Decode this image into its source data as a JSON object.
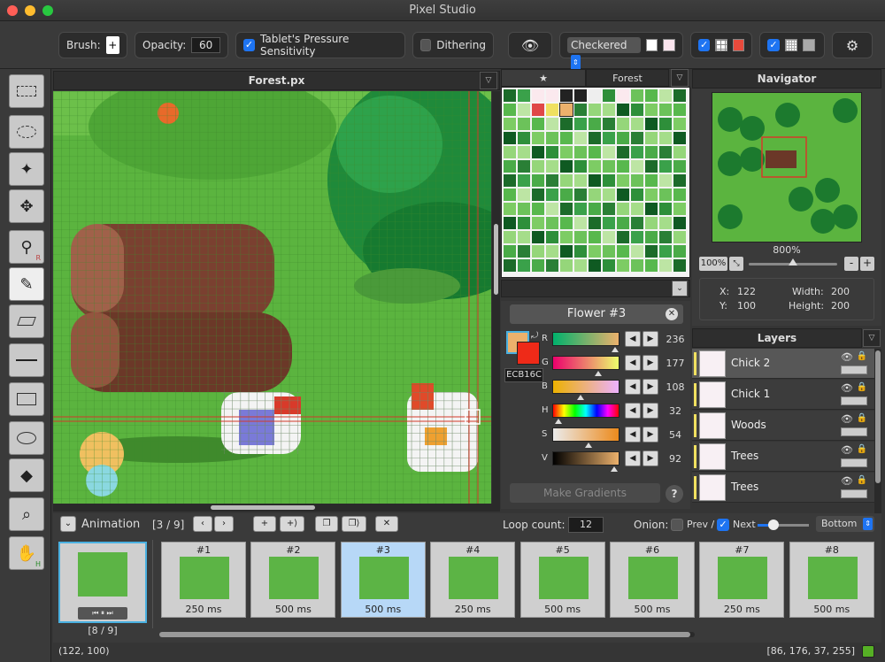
{
  "app": {
    "title": "Pixel Studio"
  },
  "toolbar": {
    "brush_label": "Brush:",
    "brush_value": "+",
    "opacity_label": "Opacity:",
    "opacity_value": "60",
    "pressure_label": "Tablet's Pressure Sensitivity",
    "pressure_checked": true,
    "dithering_label": "Dithering",
    "dithering_checked": false,
    "background_mode": "Checkered",
    "background_options": [
      "Checkered"
    ]
  },
  "tools": [
    "active-color-swatch",
    "rect-select-icon",
    "lasso-icon",
    "magic-wand-icon",
    "move-icon",
    "eyedropper-icon",
    "pencil-icon",
    "eraser-icon",
    "line-icon",
    "rectangle-icon",
    "ellipse-icon",
    "fill-bucket-icon",
    "zoom-icon",
    "hand-icon"
  ],
  "canvas": {
    "title": "Forest.px"
  },
  "palette": {
    "tab_favorites": "★",
    "tab_name": "Forest"
  },
  "color": {
    "name": "Flower #3",
    "hex": "ECB16C",
    "primary": "#ecb16c",
    "secondary": "#ee2a18",
    "sliders": [
      {
        "label": "R",
        "value": "236",
        "pos": 0.93
      },
      {
        "label": "G",
        "value": "177",
        "pos": 0.69
      },
      {
        "label": "B",
        "value": "108",
        "pos": 0.42
      },
      {
        "label": "H",
        "value": "32",
        "pos": 0.09
      },
      {
        "label": "S",
        "value": "54",
        "pos": 0.54
      },
      {
        "label": "V",
        "value": "92",
        "pos": 0.92
      }
    ],
    "make_gradients_label": "Make Gradients",
    "help_label": "?"
  },
  "navigator": {
    "title": "Navigator",
    "zoom_percent": "800%",
    "zoom_button": "100%",
    "zoom_level": 0.5,
    "x_label": "X:",
    "x_value": "122",
    "y_label": "Y:",
    "y_value": "100",
    "width_label": "Width:",
    "width_value": "200",
    "height_label": "Height:",
    "height_value": "200"
  },
  "layers": {
    "title": "Layers",
    "items": [
      {
        "name": "Chick 2",
        "locked": false
      },
      {
        "name": "Chick 1",
        "locked": false
      },
      {
        "name": "Woods",
        "locked": true
      },
      {
        "name": "Trees",
        "locked": false
      },
      {
        "name": "Trees",
        "locked": false
      }
    ]
  },
  "animation": {
    "label": "Animation",
    "counter": "[3 / 9]",
    "loop_label": "Loop count:",
    "loop_value": "12",
    "onion_label": "Onion:",
    "prev_label": "Prev /",
    "next_label": "Next",
    "prev_checked": false,
    "next_checked": true,
    "onion_level": 0.2,
    "position_option": "Bottom",
    "preview_counter": "[8 / 9]",
    "frames": [
      {
        "num": "#1",
        "ms": "250 ms"
      },
      {
        "num": "#2",
        "ms": "500 ms"
      },
      {
        "num": "#3",
        "ms": "500 ms"
      },
      {
        "num": "#4",
        "ms": "250 ms"
      },
      {
        "num": "#5",
        "ms": "500 ms"
      },
      {
        "num": "#6",
        "ms": "500 ms"
      },
      {
        "num": "#7",
        "ms": "250 ms"
      },
      {
        "num": "#8",
        "ms": "500 ms"
      }
    ],
    "selected_frame": 2
  },
  "status": {
    "cursor": "(122, 100)",
    "pixel_rgba": "[86, 176, 37, 255]",
    "pixel_color": "#56b025"
  }
}
